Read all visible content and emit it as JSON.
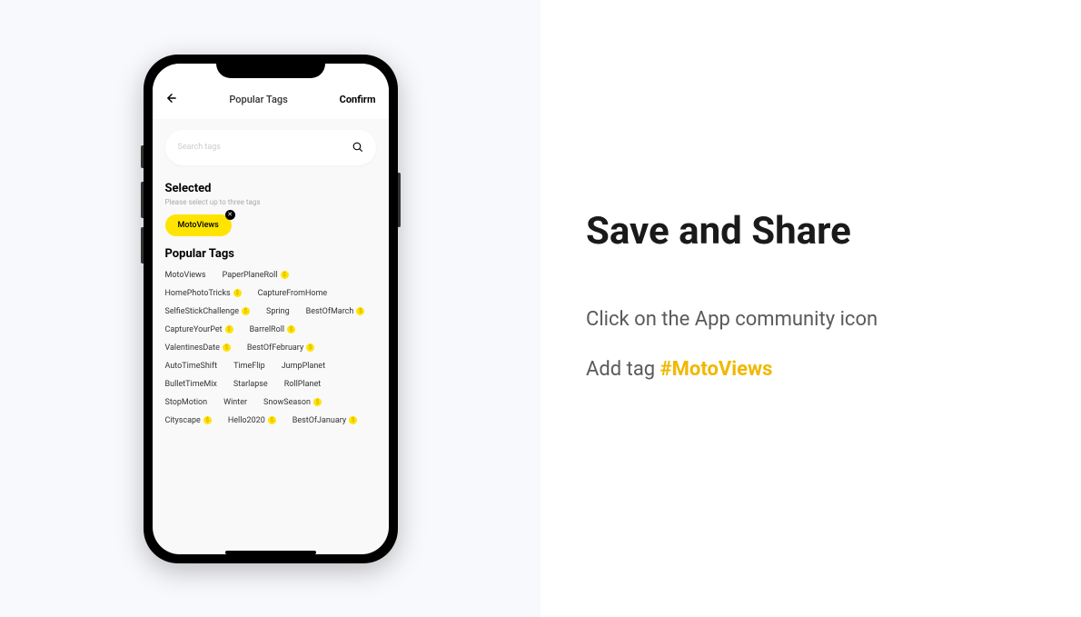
{
  "right": {
    "heading": "Save and Share",
    "instruction1": "Click on the App community icon",
    "instruction2_prefix": "Add tag ",
    "instruction2_highlight": "#MotoViews"
  },
  "app": {
    "header": {
      "title": "Popular Tags",
      "confirm": "Confirm"
    },
    "search": {
      "placeholder": "Search tags"
    },
    "selected": {
      "title": "Selected",
      "subtitle": "Please select up to three tags",
      "tag": "MotoViews"
    },
    "popular": {
      "title": "Popular Tags",
      "tags": [
        {
          "label": "MotoViews",
          "prize": false
        },
        {
          "label": "PaperPlaneRoll",
          "prize": true
        },
        {
          "label": "HomePhotoTricks",
          "prize": true
        },
        {
          "label": "CaptureFromHome",
          "prize": false
        },
        {
          "label": "SelfieStickChallenge",
          "prize": true
        },
        {
          "label": "Spring",
          "prize": false
        },
        {
          "label": "BestOfMarch",
          "prize": true
        },
        {
          "label": "CaptureYourPet",
          "prize": true
        },
        {
          "label": "BarrelRoll",
          "prize": true
        },
        {
          "label": "ValentinesDate",
          "prize": true
        },
        {
          "label": "BestOfFebruary",
          "prize": true
        },
        {
          "label": "AutoTimeShift",
          "prize": false
        },
        {
          "label": "TimeFlip",
          "prize": false
        },
        {
          "label": "JumpPlanet",
          "prize": false
        },
        {
          "label": "BulletTimeMix",
          "prize": false
        },
        {
          "label": "Starlapse",
          "prize": false
        },
        {
          "label": "RollPlanet",
          "prize": false
        },
        {
          "label": "StopMotion",
          "prize": false
        },
        {
          "label": "Winter",
          "prize": false
        },
        {
          "label": "SnowSeason",
          "prize": true
        },
        {
          "label": "Cityscape",
          "prize": true
        },
        {
          "label": "Hello2020",
          "prize": true
        },
        {
          "label": "BestOfJanuary",
          "prize": true
        }
      ]
    }
  }
}
